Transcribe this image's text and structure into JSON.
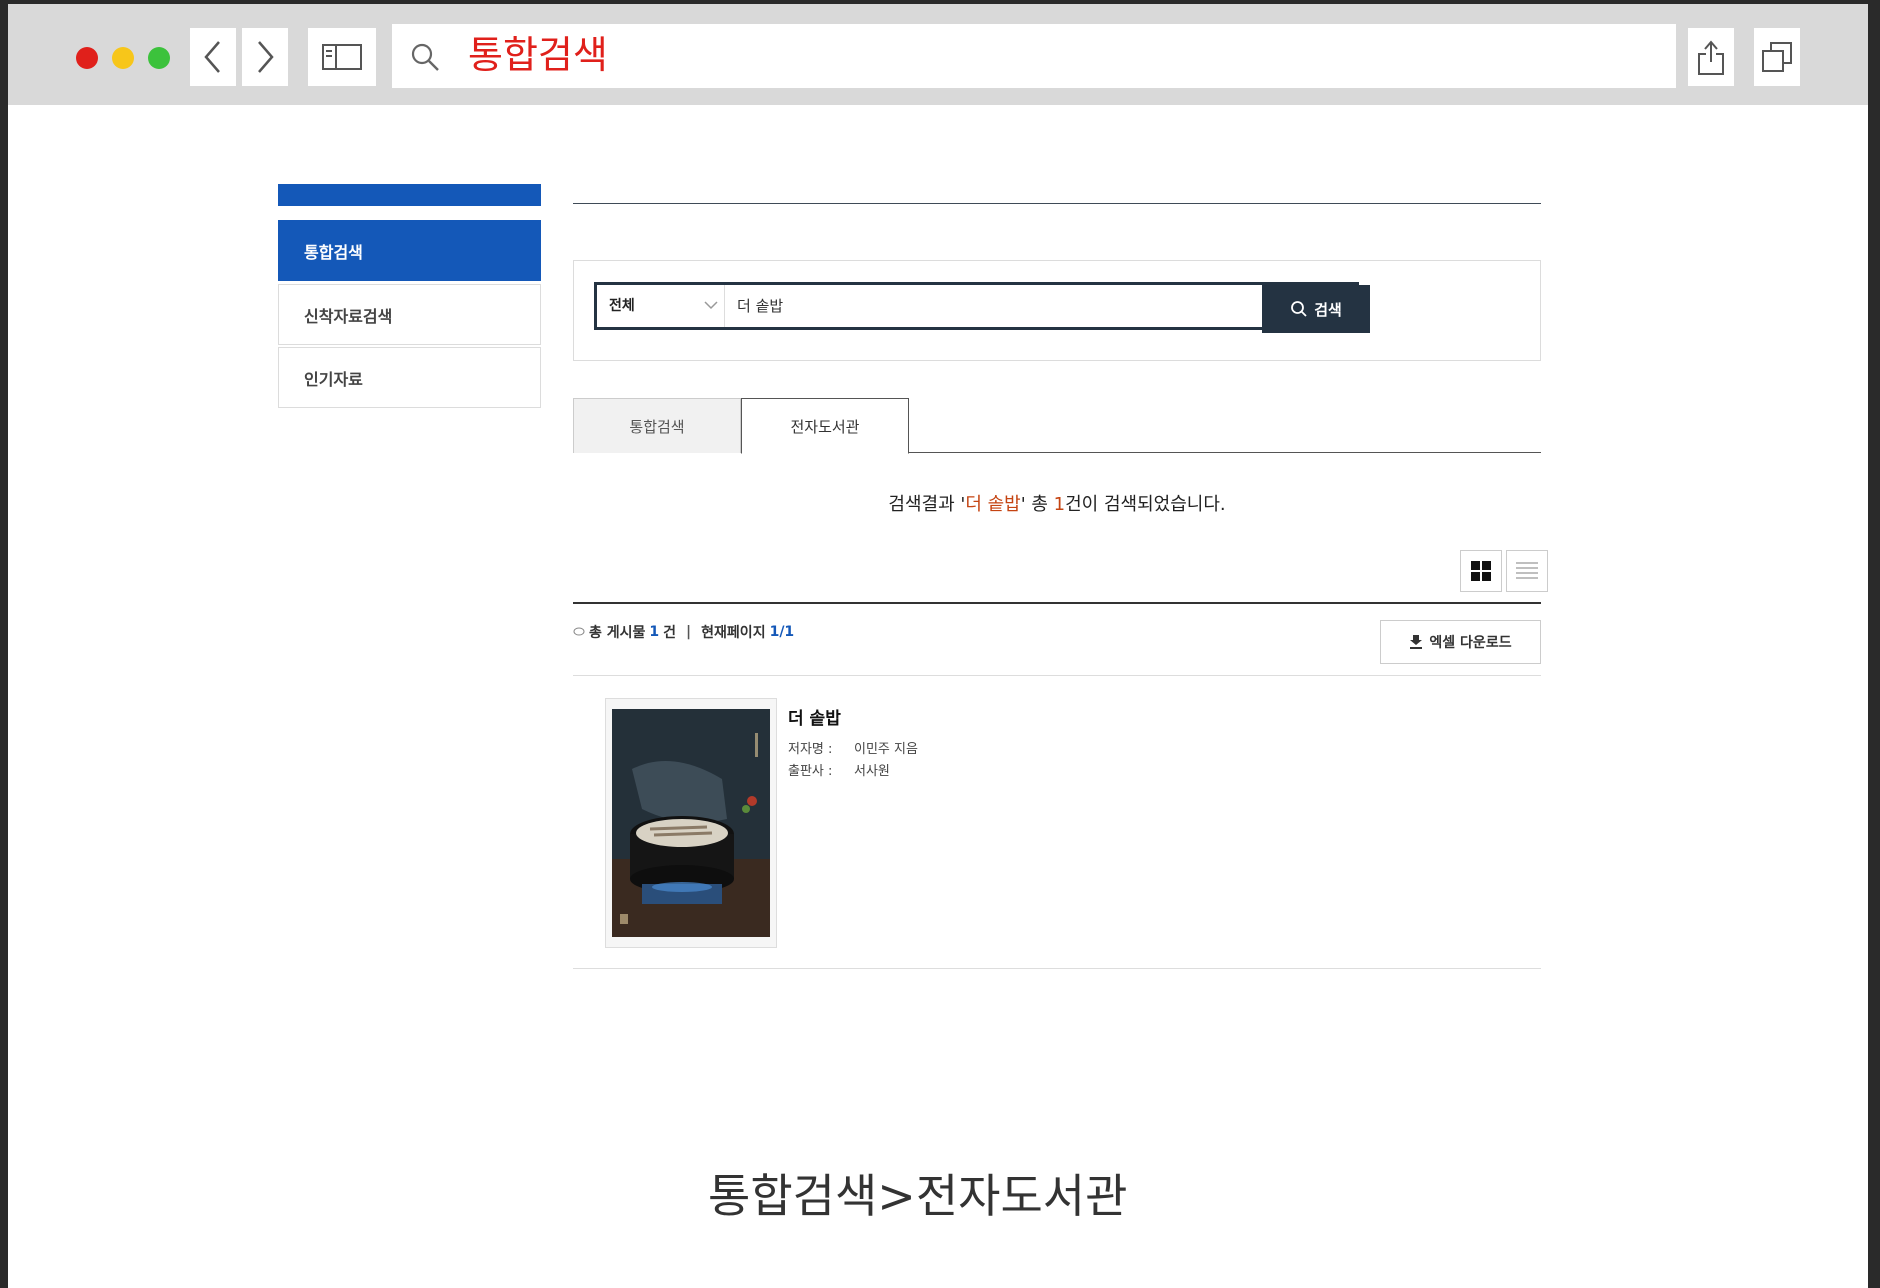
{
  "browser": {
    "address_text": "통합검색"
  },
  "sidebar": {
    "items": [
      {
        "label": "통합검색",
        "active": true
      },
      {
        "label": "신착자료검색",
        "active": false
      },
      {
        "label": "인기자료",
        "active": false
      }
    ]
  },
  "search": {
    "category": "전체",
    "query": "더 솥밥",
    "button_label": "검색"
  },
  "tabs": [
    {
      "label": "통합검색",
      "active": false
    },
    {
      "label": "전자도서관",
      "active": true
    }
  ],
  "result_message": {
    "prefix": "검색결과 '",
    "keyword": "더 솥밥",
    "middle": "' 총 ",
    "count": "1",
    "suffix": "건이 검색되었습니다."
  },
  "list_info": {
    "total_label": "총 게시물",
    "total_value": "1",
    "total_unit": "건",
    "separator": "|",
    "page_label": "현재페이지",
    "page_value": "1/1"
  },
  "excel_button_label": "엑셀 다운로드",
  "results": [
    {
      "title": "더 솥밥",
      "author_label": "저자명 :",
      "author": "이민주 지음",
      "publisher_label": "출판사 :",
      "publisher": "서사원"
    }
  ],
  "caption": "통합검색>전자도서관",
  "colors": {
    "brand_blue": "#1458b8",
    "dark_navy": "#243342",
    "highlight_orange": "#c54412",
    "title_red": "#e0201b"
  }
}
